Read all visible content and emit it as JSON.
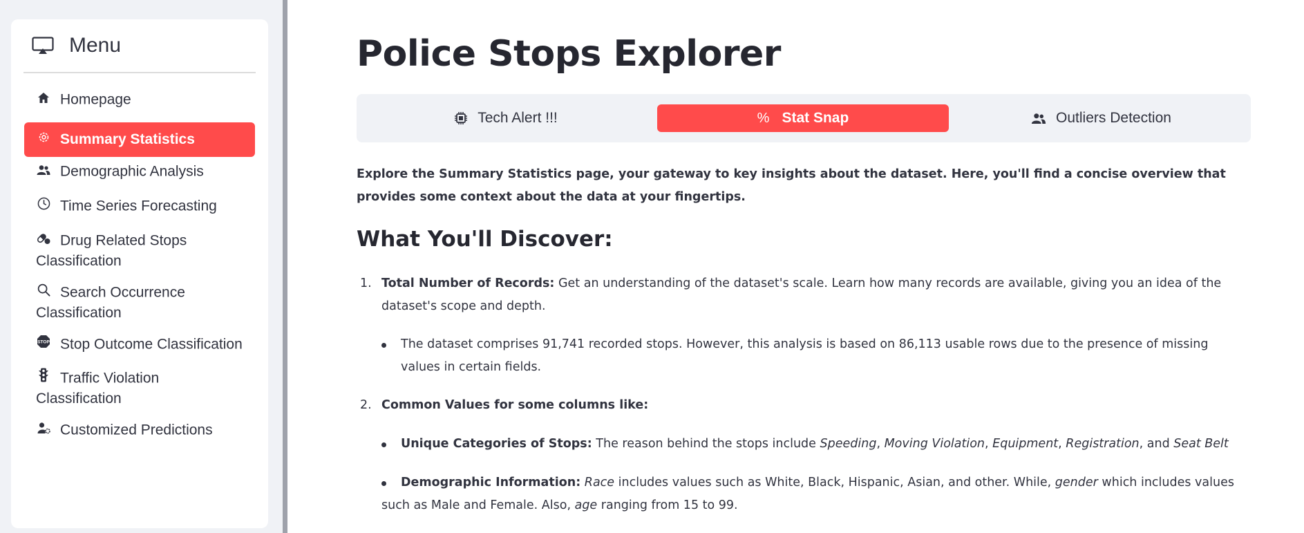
{
  "sidebar": {
    "menu_title": "Menu",
    "menu_icon": "cast-icon",
    "items": [
      {
        "label": "Homepage",
        "icon": "house-icon"
      },
      {
        "label": "Summary Statistics",
        "icon": "gear-icon"
      },
      {
        "label": "Demographic Analysis",
        "icon": "people-icon"
      },
      {
        "label": "Time Series Forecasting",
        "icon": "clock-icon"
      },
      {
        "label": "Drug Related Stops",
        "label2": "Classification",
        "icon": "capsule-icon"
      },
      {
        "label": "Search Occurrence",
        "label2": "Classification",
        "icon": "search-icon"
      },
      {
        "label": "Stop Outcome Classification",
        "icon": "stop-sign-icon"
      },
      {
        "label": "Traffic Violation",
        "label2": "Classification",
        "icon": "traffic-light-icon"
      },
      {
        "label": "Customized Predictions",
        "icon": "person-gear-icon"
      }
    ],
    "active_color": "#ff4b4b"
  },
  "main": {
    "title": "Police Stops Explorer",
    "tabs": [
      {
        "label": "Tech Alert !!!",
        "icon": "cpu-icon"
      },
      {
        "label": "Stat Snap",
        "icon": "percent-icon"
      },
      {
        "label": "Outliers Detection",
        "icon": "people-icon"
      }
    ],
    "intro": "Explore the Summary Statistics page, your gateway to key insights about the dataset. Here, you'll find a concise overview that provides some context about the data at your fingertips.",
    "section_heading": "What You'll Discover:",
    "list": [
      {
        "num": "1.",
        "title": "Total Number of Records:",
        "text": "Get an understanding of the dataset's scale. Learn how many records are available, giving you an idea of the dataset's scope and depth.",
        "bullet": "The dataset comprises 91,741 recorded stops. However, this analysis is based on 86,113 usable rows due to the presence of missing values in certain fields."
      },
      {
        "num": "2.",
        "title": "Common Values for some columns like:",
        "bullets": [
          {
            "title": "Unique Categories of Stops:",
            "t1": "The reason behind the stops include",
            "i1": "Speeding",
            "i2": "Moving Violation",
            "i3": "Equipment",
            "i4": "Registration",
            "t_and": ", and",
            "i5": "Seat Belt"
          },
          {
            "title": "Demographic Information:",
            "i_race": "Race",
            "t1": "includes values such as White, Black, Hispanic, Asian, and other. While,",
            "i_gender": "gender",
            "t2": "which includes values such as Male and Female. Also,",
            "i_age": "age",
            "t3": "ranging from 15 to 99."
          }
        ]
      }
    ]
  }
}
